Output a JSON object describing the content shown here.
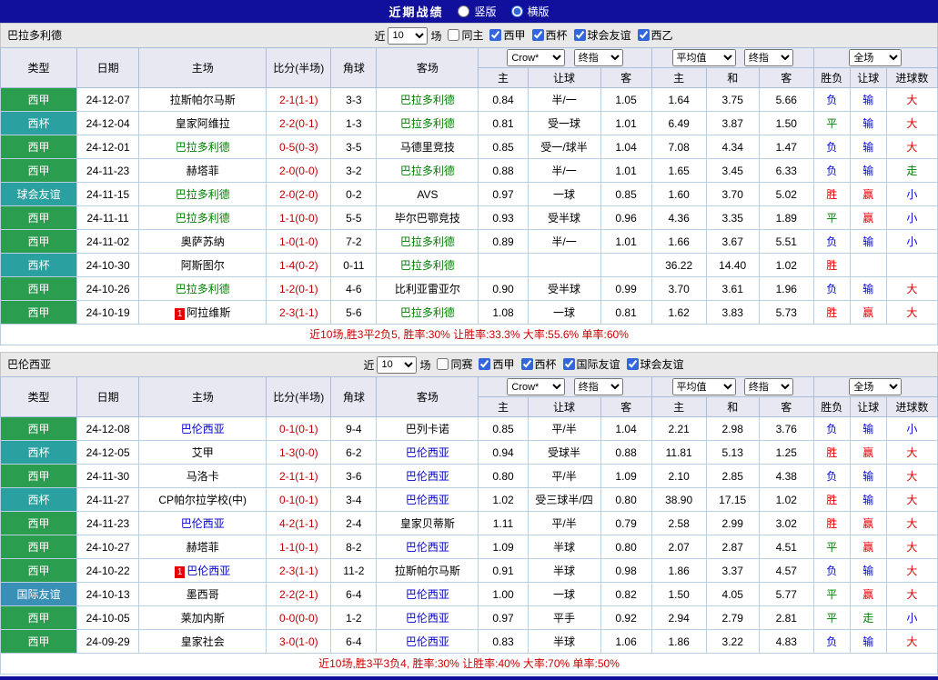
{
  "topbar": {
    "title": "近期战绩",
    "layout_options": [
      {
        "label": "竖版",
        "selected": false
      },
      {
        "label": "横版",
        "selected": true
      }
    ]
  },
  "table_head": {
    "type": "类型",
    "date": "日期",
    "home": "主场",
    "score": "比分(半场)",
    "corner": "角球",
    "away": "客场",
    "odds_source_select": "Crow*",
    "odds_time_select": "终指",
    "avg_source_select": "平均值",
    "avg_time_select": "终指",
    "scope_select": "全场",
    "odds_home": "主",
    "odds_handicap": "让球",
    "odds_away": "客",
    "avg_home": "主",
    "avg_draw": "和",
    "avg_away": "客",
    "result_wdl": "胜负",
    "result_handicap": "让球",
    "result_goals": "进球数"
  },
  "colors": {
    "topbar_bg": "#10109c",
    "header_bg": "#e8e8f3",
    "type": {
      "西甲": "#2a9d4e",
      "西杯": "#2aa0a0",
      "球会友谊": "#2aa0a0",
      "国际友谊": "#3a8fb7"
    },
    "result": {
      "胜": "#e60000",
      "平": "#008000",
      "负": "#0000e0",
      "赢": "#e60000",
      "走": "#008000",
      "输": "#0000e0",
      "大": "#e60000",
      "小": "#0000e0"
    },
    "score_text": "#c00000",
    "summary_text": "#cc0000",
    "badge_bg": "#e60000"
  },
  "sections": [
    {
      "team": "巴拉多利德",
      "team_color": "#008000",
      "filter": {
        "near_label": "近",
        "count": "10",
        "unit": "场",
        "checkboxes": [
          {
            "label": "同主",
            "checked": false
          },
          {
            "label": "西甲",
            "checked": true
          },
          {
            "label": "西杯",
            "checked": true
          },
          {
            "label": "球会友谊",
            "checked": true
          },
          {
            "label": "西乙",
            "checked": true
          }
        ]
      },
      "rows": [
        {
          "type": "西甲",
          "date": "24-12-07",
          "home": "拉斯帕尔马斯",
          "home_featured": false,
          "home_badge": "",
          "score": "2-1(1-1)",
          "corner": "3-3",
          "away": "巴拉多利德",
          "away_featured": true,
          "away_badge": "",
          "odds_home": "0.84",
          "handicap": "半/一",
          "odds_away": "1.05",
          "avg_home": "1.64",
          "avg_draw": "3.75",
          "avg_away": "5.66",
          "r_wdl": "负",
          "r_handicap": "输",
          "r_goals": "大"
        },
        {
          "type": "西杯",
          "date": "24-12-04",
          "home": "皇家阿维拉",
          "home_featured": false,
          "home_badge": "",
          "score": "2-2(0-1)",
          "corner": "1-3",
          "away": "巴拉多利德",
          "away_featured": true,
          "away_badge": "",
          "odds_home": "0.81",
          "handicap": "受一球",
          "odds_away": "1.01",
          "avg_home": "6.49",
          "avg_draw": "3.87",
          "avg_away": "1.50",
          "r_wdl": "平",
          "r_handicap": "输",
          "r_goals": "大"
        },
        {
          "type": "西甲",
          "date": "24-12-01",
          "home": "巴拉多利德",
          "home_featured": true,
          "home_badge": "",
          "score": "0-5(0-3)",
          "corner": "3-5",
          "away": "马德里竞技",
          "away_featured": false,
          "away_badge": "",
          "odds_home": "0.85",
          "handicap": "受一/球半",
          "odds_away": "1.04",
          "avg_home": "7.08",
          "avg_draw": "4.34",
          "avg_away": "1.47",
          "r_wdl": "负",
          "r_handicap": "输",
          "r_goals": "大"
        },
        {
          "type": "西甲",
          "date": "24-11-23",
          "home": "赫塔菲",
          "home_featured": false,
          "home_badge": "",
          "score": "2-0(0-0)",
          "corner": "3-2",
          "away": "巴拉多利德",
          "away_featured": true,
          "away_badge": "",
          "odds_home": "0.88",
          "handicap": "半/一",
          "odds_away": "1.01",
          "avg_home": "1.65",
          "avg_draw": "3.45",
          "avg_away": "6.33",
          "r_wdl": "负",
          "r_handicap": "输",
          "r_goals": "走"
        },
        {
          "type": "球会友谊",
          "date": "24-11-15",
          "home": "巴拉多利德",
          "home_featured": true,
          "home_badge": "",
          "score": "2-0(2-0)",
          "corner": "0-2",
          "away": "AVS",
          "away_featured": false,
          "away_badge": "",
          "odds_home": "0.97",
          "handicap": "一球",
          "odds_away": "0.85",
          "avg_home": "1.60",
          "avg_draw": "3.70",
          "avg_away": "5.02",
          "r_wdl": "胜",
          "r_handicap": "赢",
          "r_goals": "小"
        },
        {
          "type": "西甲",
          "date": "24-11-11",
          "home": "巴拉多利德",
          "home_featured": true,
          "home_badge": "",
          "score": "1-1(0-0)",
          "corner": "5-5",
          "away": "毕尔巴鄂竞技",
          "away_featured": false,
          "away_badge": "",
          "odds_home": "0.93",
          "handicap": "受半球",
          "odds_away": "0.96",
          "avg_home": "4.36",
          "avg_draw": "3.35",
          "avg_away": "1.89",
          "r_wdl": "平",
          "r_handicap": "赢",
          "r_goals": "小"
        },
        {
          "type": "西甲",
          "date": "24-11-02",
          "home": "奥萨苏纳",
          "home_featured": false,
          "home_badge": "",
          "score": "1-0(1-0)",
          "corner": "7-2",
          "away": "巴拉多利德",
          "away_featured": true,
          "away_badge": "",
          "odds_home": "0.89",
          "handicap": "半/一",
          "odds_away": "1.01",
          "avg_home": "1.66",
          "avg_draw": "3.67",
          "avg_away": "5.51",
          "r_wdl": "负",
          "r_handicap": "输",
          "r_goals": "小"
        },
        {
          "type": "西杯",
          "date": "24-10-30",
          "home": "阿斯图尔",
          "home_featured": false,
          "home_badge": "",
          "score": "1-4(0-2)",
          "corner": "0-11",
          "away": "巴拉多利德",
          "away_featured": true,
          "away_badge": "",
          "odds_home": "",
          "handicap": "",
          "odds_away": "",
          "avg_home": "36.22",
          "avg_draw": "14.40",
          "avg_away": "1.02",
          "r_wdl": "胜",
          "r_handicap": "",
          "r_goals": ""
        },
        {
          "type": "西甲",
          "date": "24-10-26",
          "home": "巴拉多利德",
          "home_featured": true,
          "home_badge": "",
          "score": "1-2(0-1)",
          "corner": "4-6",
          "away": "比利亚雷亚尔",
          "away_featured": false,
          "away_badge": "",
          "odds_home": "0.90",
          "handicap": "受半球",
          "odds_away": "0.99",
          "avg_home": "3.70",
          "avg_draw": "3.61",
          "avg_away": "1.96",
          "r_wdl": "负",
          "r_handicap": "输",
          "r_goals": "大"
        },
        {
          "type": "西甲",
          "date": "24-10-19",
          "home": "阿拉维斯",
          "home_featured": false,
          "home_badge": "1",
          "score": "2-3(1-1)",
          "corner": "5-6",
          "away": "巴拉多利德",
          "away_featured": true,
          "away_badge": "",
          "odds_home": "1.08",
          "handicap": "一球",
          "odds_away": "0.81",
          "avg_home": "1.62",
          "avg_draw": "3.83",
          "avg_away": "5.73",
          "r_wdl": "胜",
          "r_handicap": "赢",
          "r_goals": "大"
        }
      ],
      "summary": "近10场,胜3平2负5, 胜率:30% 让胜率:33.3% 大率:55.6% 单率:60%"
    },
    {
      "team": "巴伦西亚",
      "team_color": "#0000cc",
      "filter": {
        "near_label": "近",
        "count": "10",
        "unit": "场",
        "checkboxes": [
          {
            "label": "同赛",
            "checked": false
          },
          {
            "label": "西甲",
            "checked": true
          },
          {
            "label": "西杯",
            "checked": true
          },
          {
            "label": "国际友谊",
            "checked": true
          },
          {
            "label": "球会友谊",
            "checked": true
          }
        ]
      },
      "rows": [
        {
          "type": "西甲",
          "date": "24-12-08",
          "home": "巴伦西亚",
          "home_featured": true,
          "home_badge": "",
          "score": "0-1(0-1)",
          "corner": "9-4",
          "away": "巴列卡诺",
          "away_featured": false,
          "away_badge": "",
          "odds_home": "0.85",
          "handicap": "平/半",
          "odds_away": "1.04",
          "avg_home": "2.21",
          "avg_draw": "2.98",
          "avg_away": "3.76",
          "r_wdl": "负",
          "r_handicap": "输",
          "r_goals": "小"
        },
        {
          "type": "西杯",
          "date": "24-12-05",
          "home": "艾甲",
          "home_featured": false,
          "home_badge": "",
          "score": "1-3(0-0)",
          "corner": "6-2",
          "away": "巴伦西亚",
          "away_featured": true,
          "away_badge": "",
          "odds_home": "0.94",
          "handicap": "受球半",
          "odds_away": "0.88",
          "avg_home": "11.81",
          "avg_draw": "5.13",
          "avg_away": "1.25",
          "r_wdl": "胜",
          "r_handicap": "赢",
          "r_goals": "大"
        },
        {
          "type": "西甲",
          "date": "24-11-30",
          "home": "马洛卡",
          "home_featured": false,
          "home_badge": "",
          "score": "2-1(1-1)",
          "corner": "3-6",
          "away": "巴伦西亚",
          "away_featured": true,
          "away_badge": "",
          "odds_home": "0.80",
          "handicap": "平/半",
          "odds_away": "1.09",
          "avg_home": "2.10",
          "avg_draw": "2.85",
          "avg_away": "4.38",
          "r_wdl": "负",
          "r_handicap": "输",
          "r_goals": "大"
        },
        {
          "type": "西杯",
          "date": "24-11-27",
          "home": "CP帕尔拉学校(中)",
          "home_featured": false,
          "home_badge": "",
          "score": "0-1(0-1)",
          "corner": "3-4",
          "away": "巴伦西亚",
          "away_featured": true,
          "away_badge": "",
          "odds_home": "1.02",
          "handicap": "受三球半/四",
          "odds_away": "0.80",
          "avg_home": "38.90",
          "avg_draw": "17.15",
          "avg_away": "1.02",
          "r_wdl": "胜",
          "r_handicap": "输",
          "r_goals": "大"
        },
        {
          "type": "西甲",
          "date": "24-11-23",
          "home": "巴伦西亚",
          "home_featured": true,
          "home_badge": "",
          "score": "4-2(1-1)",
          "corner": "2-4",
          "away": "皇家贝蒂斯",
          "away_featured": false,
          "away_badge": "",
          "odds_home": "1.11",
          "handicap": "平/半",
          "odds_away": "0.79",
          "avg_home": "2.58",
          "avg_draw": "2.99",
          "avg_away": "3.02",
          "r_wdl": "胜",
          "r_handicap": "赢",
          "r_goals": "大"
        },
        {
          "type": "西甲",
          "date": "24-10-27",
          "home": "赫塔菲",
          "home_featured": false,
          "home_badge": "",
          "score": "1-1(0-1)",
          "corner": "8-2",
          "away": "巴伦西亚",
          "away_featured": true,
          "away_badge": "",
          "odds_home": "1.09",
          "handicap": "半球",
          "odds_away": "0.80",
          "avg_home": "2.07",
          "avg_draw": "2.87",
          "avg_away": "4.51",
          "r_wdl": "平",
          "r_handicap": "赢",
          "r_goals": "大"
        },
        {
          "type": "西甲",
          "date": "24-10-22",
          "home": "巴伦西亚",
          "home_featured": true,
          "home_badge": "1",
          "score": "2-3(1-1)",
          "corner": "11-2",
          "away": "拉斯帕尔马斯",
          "away_featured": false,
          "away_badge": "",
          "odds_home": "0.91",
          "handicap": "半球",
          "odds_away": "0.98",
          "avg_home": "1.86",
          "avg_draw": "3.37",
          "avg_away": "4.57",
          "r_wdl": "负",
          "r_handicap": "输",
          "r_goals": "大"
        },
        {
          "type": "国际友谊",
          "date": "24-10-13",
          "home": "墨西哥",
          "home_featured": false,
          "home_badge": "",
          "score": "2-2(2-1)",
          "corner": "6-4",
          "away": "巴伦西亚",
          "away_featured": true,
          "away_badge": "",
          "odds_home": "1.00",
          "handicap": "一球",
          "odds_away": "0.82",
          "avg_home": "1.50",
          "avg_draw": "4.05",
          "avg_away": "5.77",
          "r_wdl": "平",
          "r_handicap": "赢",
          "r_goals": "大"
        },
        {
          "type": "西甲",
          "date": "24-10-05",
          "home": "莱加内斯",
          "home_featured": false,
          "home_badge": "",
          "score": "0-0(0-0)",
          "corner": "1-2",
          "away": "巴伦西亚",
          "away_featured": true,
          "away_badge": "",
          "odds_home": "0.97",
          "handicap": "平手",
          "odds_away": "0.92",
          "avg_home": "2.94",
          "avg_draw": "2.79",
          "avg_away": "2.81",
          "r_wdl": "平",
          "r_handicap": "走",
          "r_goals": "小"
        },
        {
          "type": "西甲",
          "date": "24-09-29",
          "home": "皇家社会",
          "home_featured": false,
          "home_badge": "",
          "score": "3-0(1-0)",
          "corner": "6-4",
          "away": "巴伦西亚",
          "away_featured": true,
          "away_badge": "",
          "odds_home": "0.83",
          "handicap": "半球",
          "odds_away": "1.06",
          "avg_home": "1.86",
          "avg_draw": "3.22",
          "avg_away": "4.83",
          "r_wdl": "负",
          "r_handicap": "输",
          "r_goals": "大"
        }
      ],
      "summary": "近10场,胜3平3负4, 胜率:30% 让胜率:40% 大率:70% 单率:50%"
    }
  ]
}
